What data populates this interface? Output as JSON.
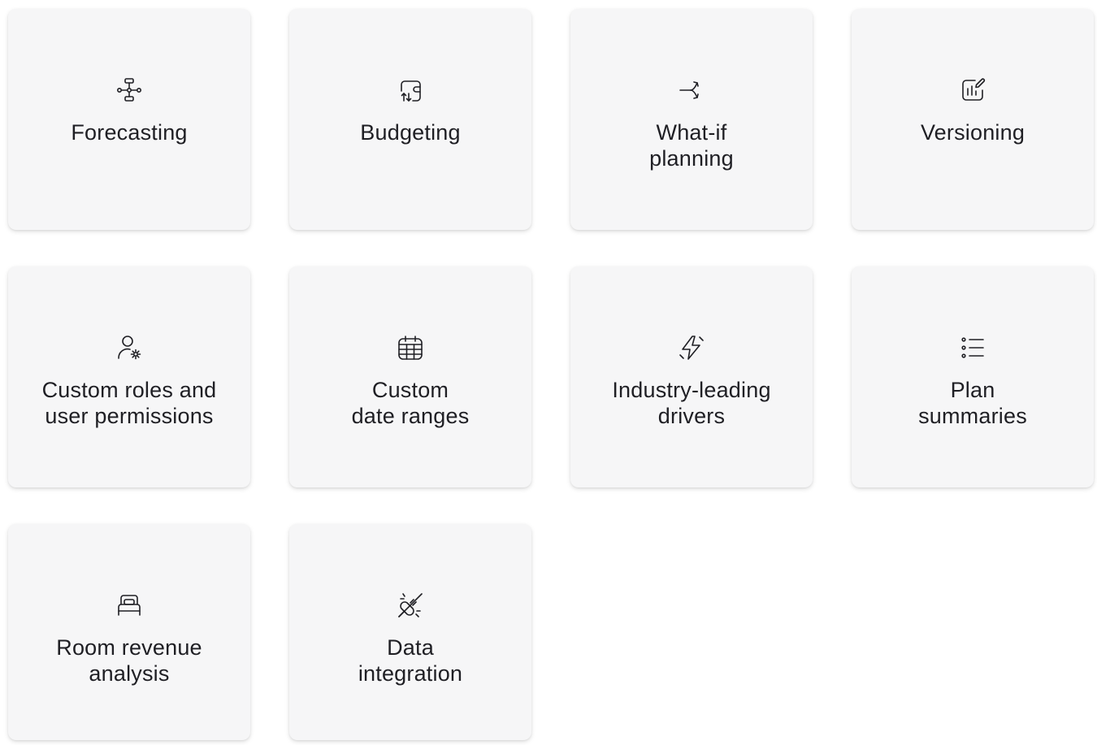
{
  "cards": [
    {
      "label": "Forecasting",
      "icon": "flowchart-icon"
    },
    {
      "label": "Budgeting",
      "icon": "wallet-transfer-icon"
    },
    {
      "label": "What-if\nplanning",
      "icon": "split-arrow-icon"
    },
    {
      "label": "Versioning",
      "icon": "chart-edit-icon"
    },
    {
      "label": "Custom roles and\nuser permissions",
      "icon": "user-settings-icon"
    },
    {
      "label": "Custom\ndate ranges",
      "icon": "calendar-icon"
    },
    {
      "label": "Industry-leading\ndrivers",
      "icon": "lightning-icon"
    },
    {
      "label": "Plan\nsummaries",
      "icon": "list-icon"
    },
    {
      "label": "Room revenue\nanalysis",
      "icon": "bed-icon"
    },
    {
      "label": "Data\nintegration",
      "icon": "plug-icon"
    }
  ],
  "colors": {
    "card_background": "#f6f6f7",
    "text": "#1f1f24"
  }
}
